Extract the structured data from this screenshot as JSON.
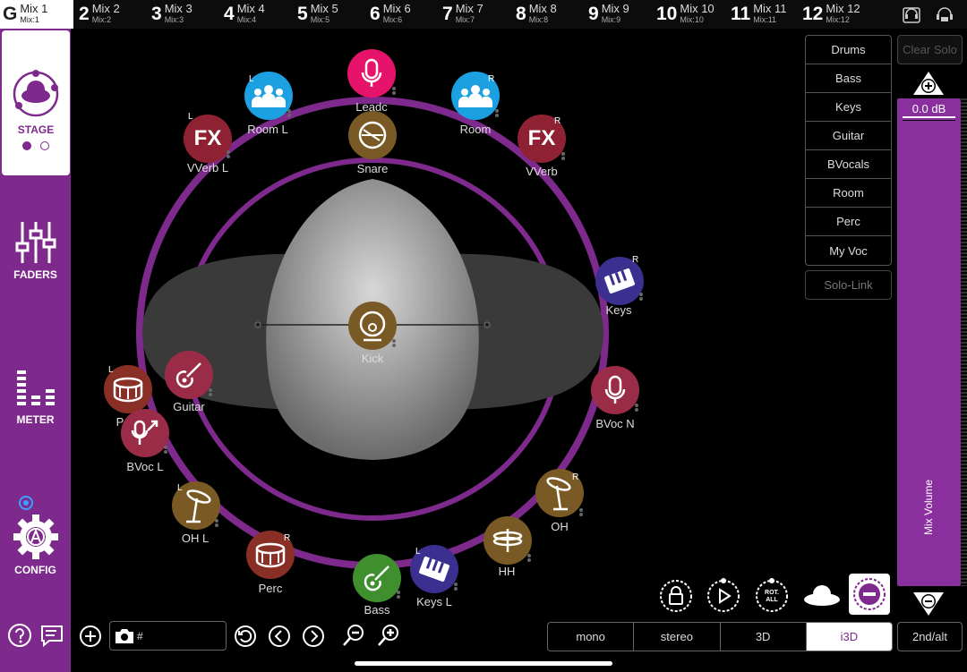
{
  "mix_tabs": [
    {
      "num": "G",
      "label": "Mix 1",
      "sub": "Mix:1",
      "active": true
    },
    {
      "num": "2",
      "label": "Mix 2",
      "sub": "Mix:2"
    },
    {
      "num": "3",
      "label": "Mix 3",
      "sub": "Mix:3"
    },
    {
      "num": "4",
      "label": "Mix 4",
      "sub": "Mix:4"
    },
    {
      "num": "5",
      "label": "Mix 5",
      "sub": "Mix:5"
    },
    {
      "num": "6",
      "label": "Mix 6",
      "sub": "Mix:6"
    },
    {
      "num": "7",
      "label": "Mix 7",
      "sub": "Mix:7"
    },
    {
      "num": "8",
      "label": "Mix 8",
      "sub": "Mix:8"
    },
    {
      "num": "9",
      "label": "Mix 9",
      "sub": "Mix:9"
    },
    {
      "num": "10",
      "label": "Mix 10",
      "sub": "Mix:10"
    },
    {
      "num": "11",
      "label": "Mix 11",
      "sub": "Mix:11"
    },
    {
      "num": "12",
      "label": "Mix 12",
      "sub": "Mix:12"
    }
  ],
  "sidebar": {
    "stage": "STAGE",
    "faders": "FADERS",
    "meter": "METER",
    "config": "CONFIG"
  },
  "channels": {
    "leadc": "Leadc",
    "room_l": "Room L",
    "room": "Room",
    "vverb_l": "VVerb L",
    "vverb": "VVerb",
    "snare": "Snare",
    "keys": "Keys",
    "kick": "Kick",
    "guitar": "Guitar",
    "p": "P",
    "bvoc_l": "BVoc L",
    "bvoc_n": "BVoc N",
    "oh_l": "OH L",
    "oh": "OH",
    "hh": "HH",
    "perc": "Perc",
    "bass": "Bass",
    "keys_l": "Keys L"
  },
  "fx_text": "FX",
  "side_tags": {
    "l": "L",
    "r": "R"
  },
  "group_list": [
    "Drums",
    "Bass",
    "Keys",
    "Guitar",
    "BVocals",
    "Room",
    "Perc",
    "My Voc"
  ],
  "clear_solo": "Clear Solo",
  "solo_link": "Solo-Link",
  "volume": {
    "value": "0.0 dB",
    "label": "Mix Volume"
  },
  "icon_labels": {
    "rot_all": "ROT. ALL"
  },
  "bottom": {
    "name_field_value": "#",
    "modes": [
      {
        "label": "mono"
      },
      {
        "label": "stereo"
      },
      {
        "label": "3D"
      },
      {
        "label": "i3D",
        "selected": true
      }
    ],
    "alt": "2nd/alt"
  },
  "colors": {
    "accent": "#7d2a8c",
    "ring": "#8a2f9e",
    "vocal": "#e6136b",
    "room": "#1ba1e2",
    "fx": "#8f2232",
    "drum": "#7a5a24",
    "keys": "#3b2f8f",
    "guitar": "#9b2c48",
    "bass": "#3f8f2f",
    "perc": "#8a2f26"
  }
}
